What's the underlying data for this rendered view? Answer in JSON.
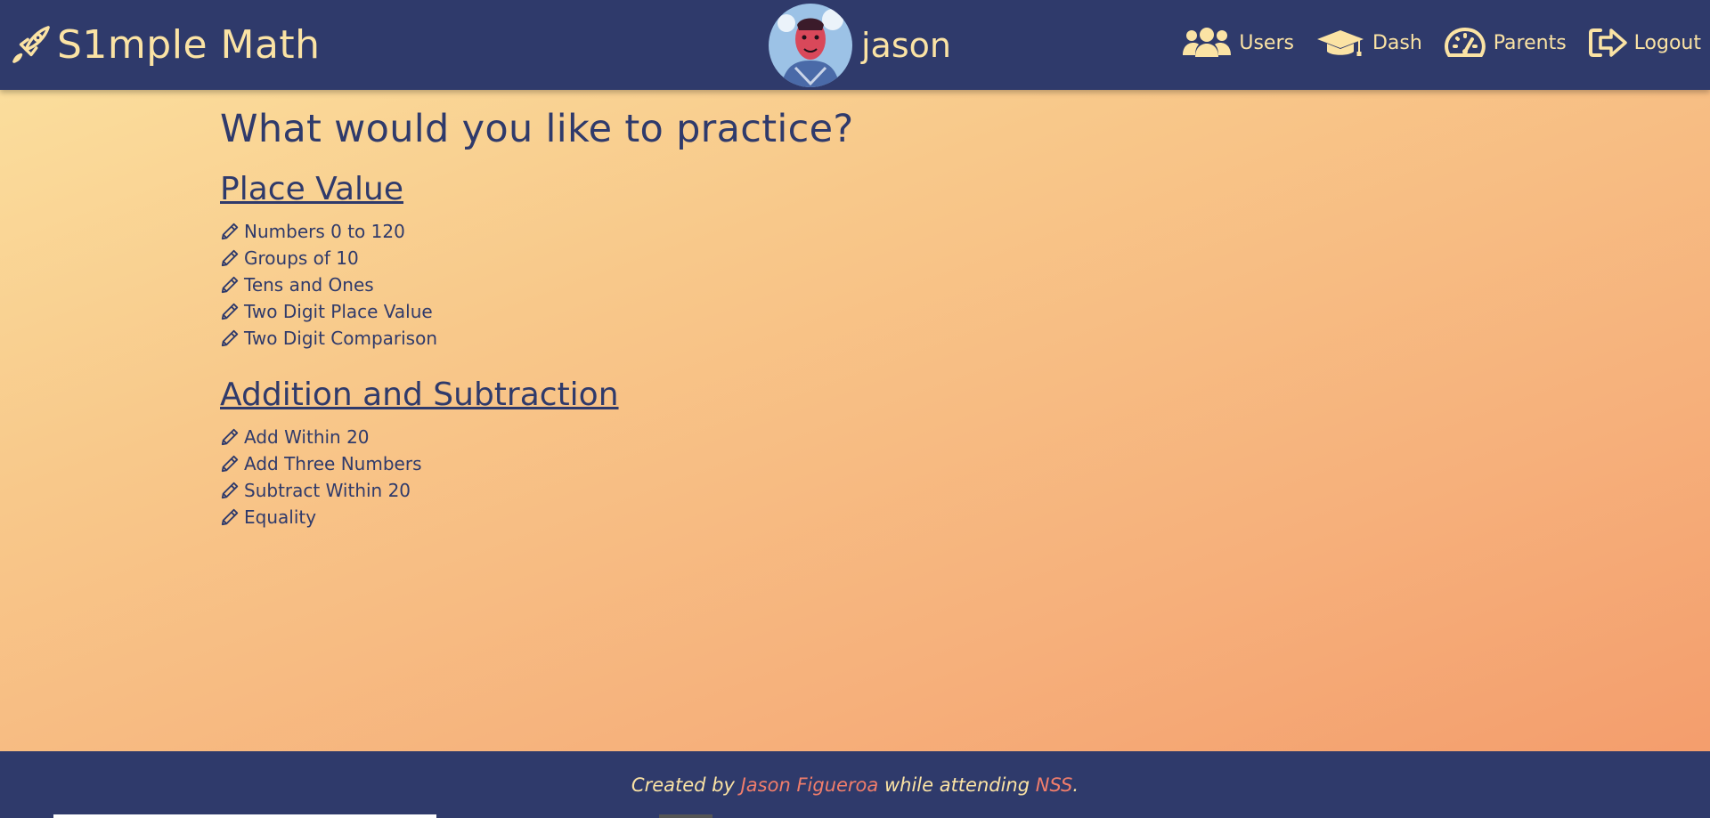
{
  "header": {
    "brand_name": "S1mple Math",
    "brand_icon": "rocket-icon",
    "username": "jason",
    "nav": [
      {
        "label": "Users",
        "icon": "users-icon"
      },
      {
        "label": "Dash",
        "icon": "graduation-cap-icon"
      },
      {
        "label": "Parents",
        "icon": "dashboard-gauge-icon"
      },
      {
        "label": "Logout",
        "icon": "sign-out-icon"
      }
    ]
  },
  "main": {
    "title": "What would you like to practice?",
    "sections": [
      {
        "title": "Place Value",
        "lessons": [
          "Numbers 0 to 120",
          "Groups of 10",
          "Tens and Ones",
          "Two Digit Place Value",
          "Two Digit Comparison"
        ]
      },
      {
        "title": "Addition and Subtraction",
        "lessons": [
          "Add Within 20",
          "Add Three Numbers",
          "Subtract Within 20",
          "Equality"
        ]
      }
    ]
  },
  "footer": {
    "prefix": "Created by ",
    "author": "Jason Figueroa",
    "middle": " while attending ",
    "school": "NSS",
    "suffix": "."
  },
  "colors": {
    "navy": "#2f3a6b",
    "cream": "#fbe3a4",
    "link_coral": "#f07d6b"
  }
}
